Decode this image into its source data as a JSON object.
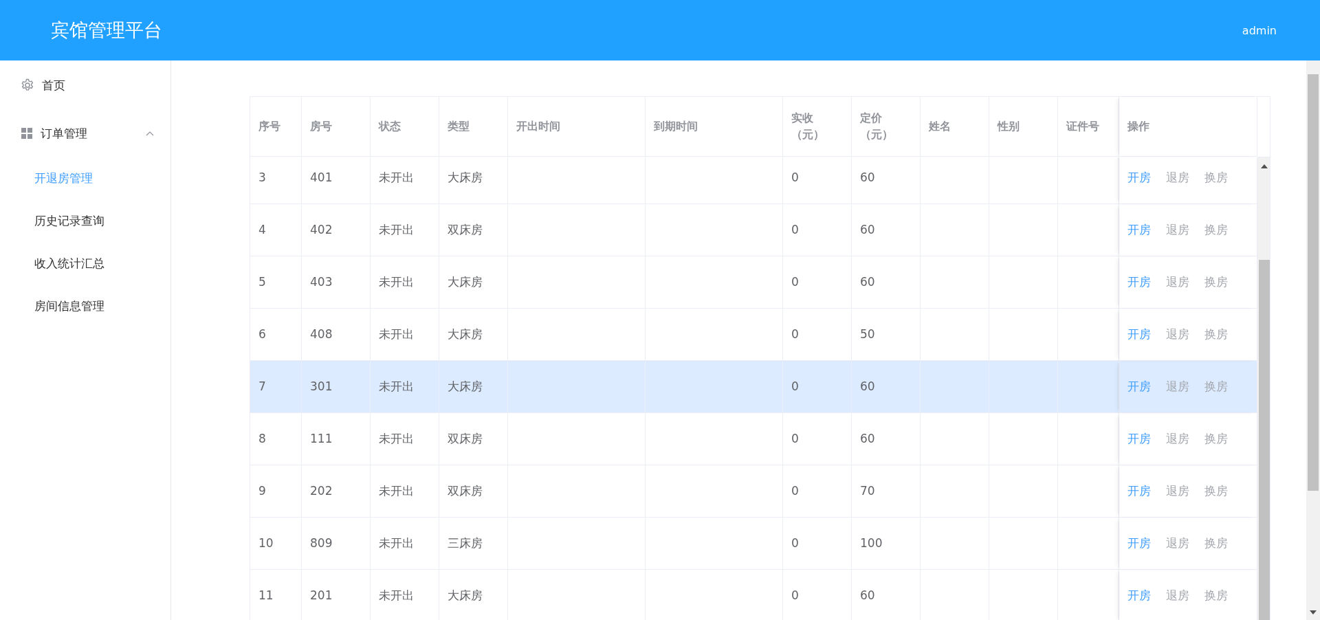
{
  "header": {
    "title": "宾馆管理平台",
    "user": "admin"
  },
  "sidebar": {
    "items": [
      {
        "label": "首页"
      },
      {
        "label": "订单管理",
        "expanded": true,
        "children": [
          {
            "label": "开退房管理",
            "selected": true
          },
          {
            "label": "历史记录查询",
            "selected": false
          },
          {
            "label": "收入统计汇总",
            "selected": false
          },
          {
            "label": "房间信息管理",
            "selected": false
          }
        ]
      }
    ]
  },
  "table": {
    "columns": [
      "序号",
      "房号",
      "状态",
      "类型",
      "开出时间",
      "到期时间",
      "实收（元）",
      "定价（元）",
      "姓名",
      "性别",
      "证件号",
      "操作"
    ],
    "rows": [
      {
        "no": "3",
        "room": "401",
        "status": "未开出",
        "type": "大床房",
        "received": "0",
        "price": "60",
        "selected": false,
        "actions": [
          {
            "label": "开房",
            "disabled": false
          },
          {
            "label": "退房",
            "disabled": true
          },
          {
            "label": "换房",
            "disabled": true
          }
        ]
      },
      {
        "no": "4",
        "room": "402",
        "status": "未开出",
        "type": "双床房",
        "received": "0",
        "price": "60",
        "selected": false,
        "actions": [
          {
            "label": "开房",
            "disabled": false
          },
          {
            "label": "退房",
            "disabled": true
          },
          {
            "label": "换房",
            "disabled": true
          }
        ]
      },
      {
        "no": "5",
        "room": "403",
        "status": "未开出",
        "type": "大床房",
        "received": "0",
        "price": "60",
        "selected": false,
        "actions": [
          {
            "label": "开房",
            "disabled": false
          },
          {
            "label": "退房",
            "disabled": true
          },
          {
            "label": "换房",
            "disabled": true
          }
        ]
      },
      {
        "no": "6",
        "room": "408",
        "status": "未开出",
        "type": "大床房",
        "received": "0",
        "price": "50",
        "selected": false,
        "actions": [
          {
            "label": "开房",
            "disabled": false
          },
          {
            "label": "退房",
            "disabled": true
          },
          {
            "label": "换房",
            "disabled": true
          }
        ]
      },
      {
        "no": "7",
        "room": "301",
        "status": "未开出",
        "type": "大床房",
        "received": "0",
        "price": "60",
        "selected": true,
        "actions": [
          {
            "label": "开房",
            "disabled": false
          },
          {
            "label": "退房",
            "disabled": true
          },
          {
            "label": "换房",
            "disabled": true
          }
        ]
      },
      {
        "no": "8",
        "room": "111",
        "status": "未开出",
        "type": "双床房",
        "received": "0",
        "price": "60",
        "selected": false,
        "actions": [
          {
            "label": "开房",
            "disabled": false
          },
          {
            "label": "退房",
            "disabled": true
          },
          {
            "label": "换房",
            "disabled": true
          }
        ]
      },
      {
        "no": "9",
        "room": "202",
        "status": "未开出",
        "type": "双床房",
        "received": "0",
        "price": "70",
        "selected": false,
        "actions": [
          {
            "label": "开房",
            "disabled": false
          },
          {
            "label": "退房",
            "disabled": true
          },
          {
            "label": "换房",
            "disabled": true
          }
        ]
      },
      {
        "no": "10",
        "room": "809",
        "status": "未开出",
        "type": "三床房",
        "received": "0",
        "price": "100",
        "selected": false,
        "actions": [
          {
            "label": "开房",
            "disabled": false
          },
          {
            "label": "退房",
            "disabled": true
          },
          {
            "label": "换房",
            "disabled": true
          }
        ]
      },
      {
        "no": "11",
        "room": "201",
        "status": "未开出",
        "type": "大床房",
        "received": "0",
        "price": "60",
        "selected": false,
        "actions": [
          {
            "label": "开房",
            "disabled": false
          },
          {
            "label": "退房",
            "disabled": true
          },
          {
            "label": "换房",
            "disabled": true
          }
        ]
      }
    ]
  }
}
